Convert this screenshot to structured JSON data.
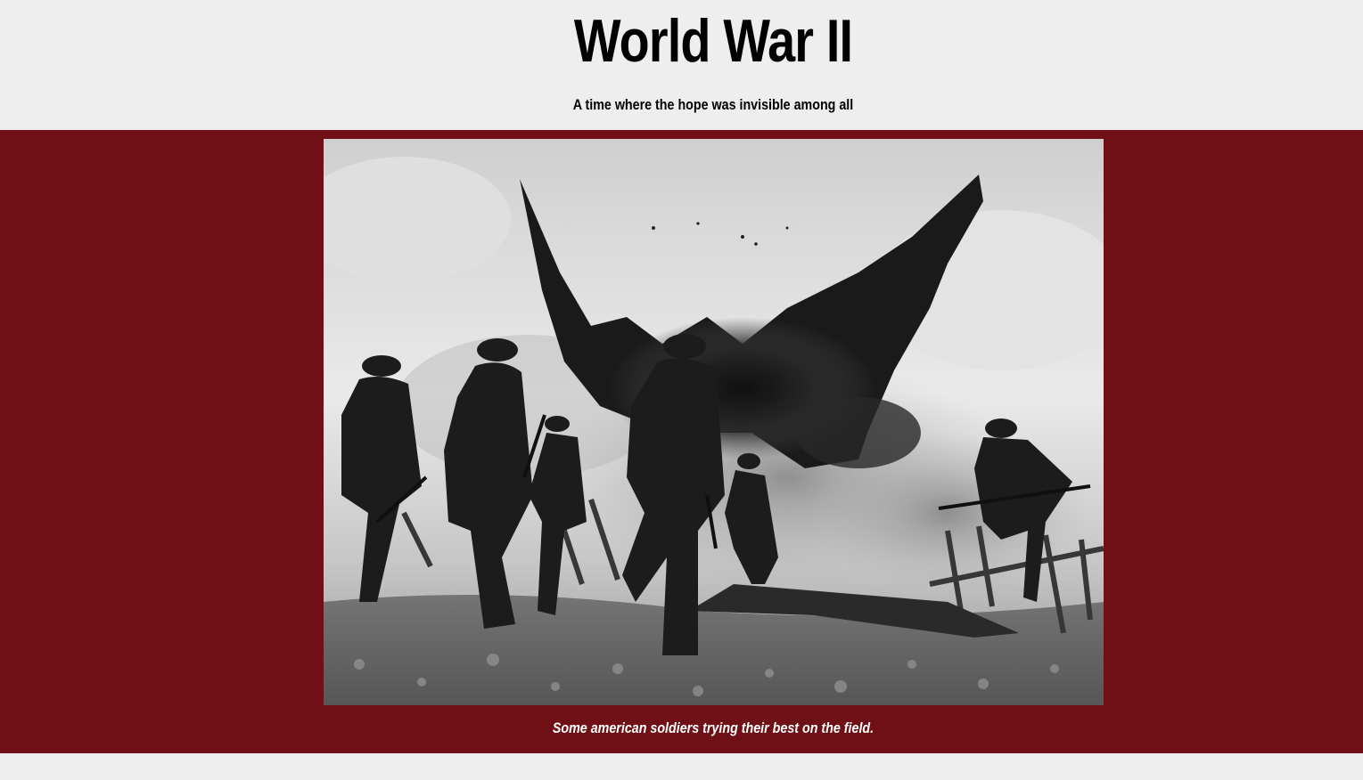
{
  "header": {
    "title": "World War II",
    "subtitle": "A time where the hope was invisible among all"
  },
  "figure": {
    "image_subject": "soldiers-charging-explosion-photo",
    "caption": "Some american soldiers trying their best on the field."
  },
  "colors": {
    "page_background": "#eeeeee",
    "band_background": "#6e1016",
    "caption_text": "#ffffff",
    "title_text": "#000000"
  }
}
